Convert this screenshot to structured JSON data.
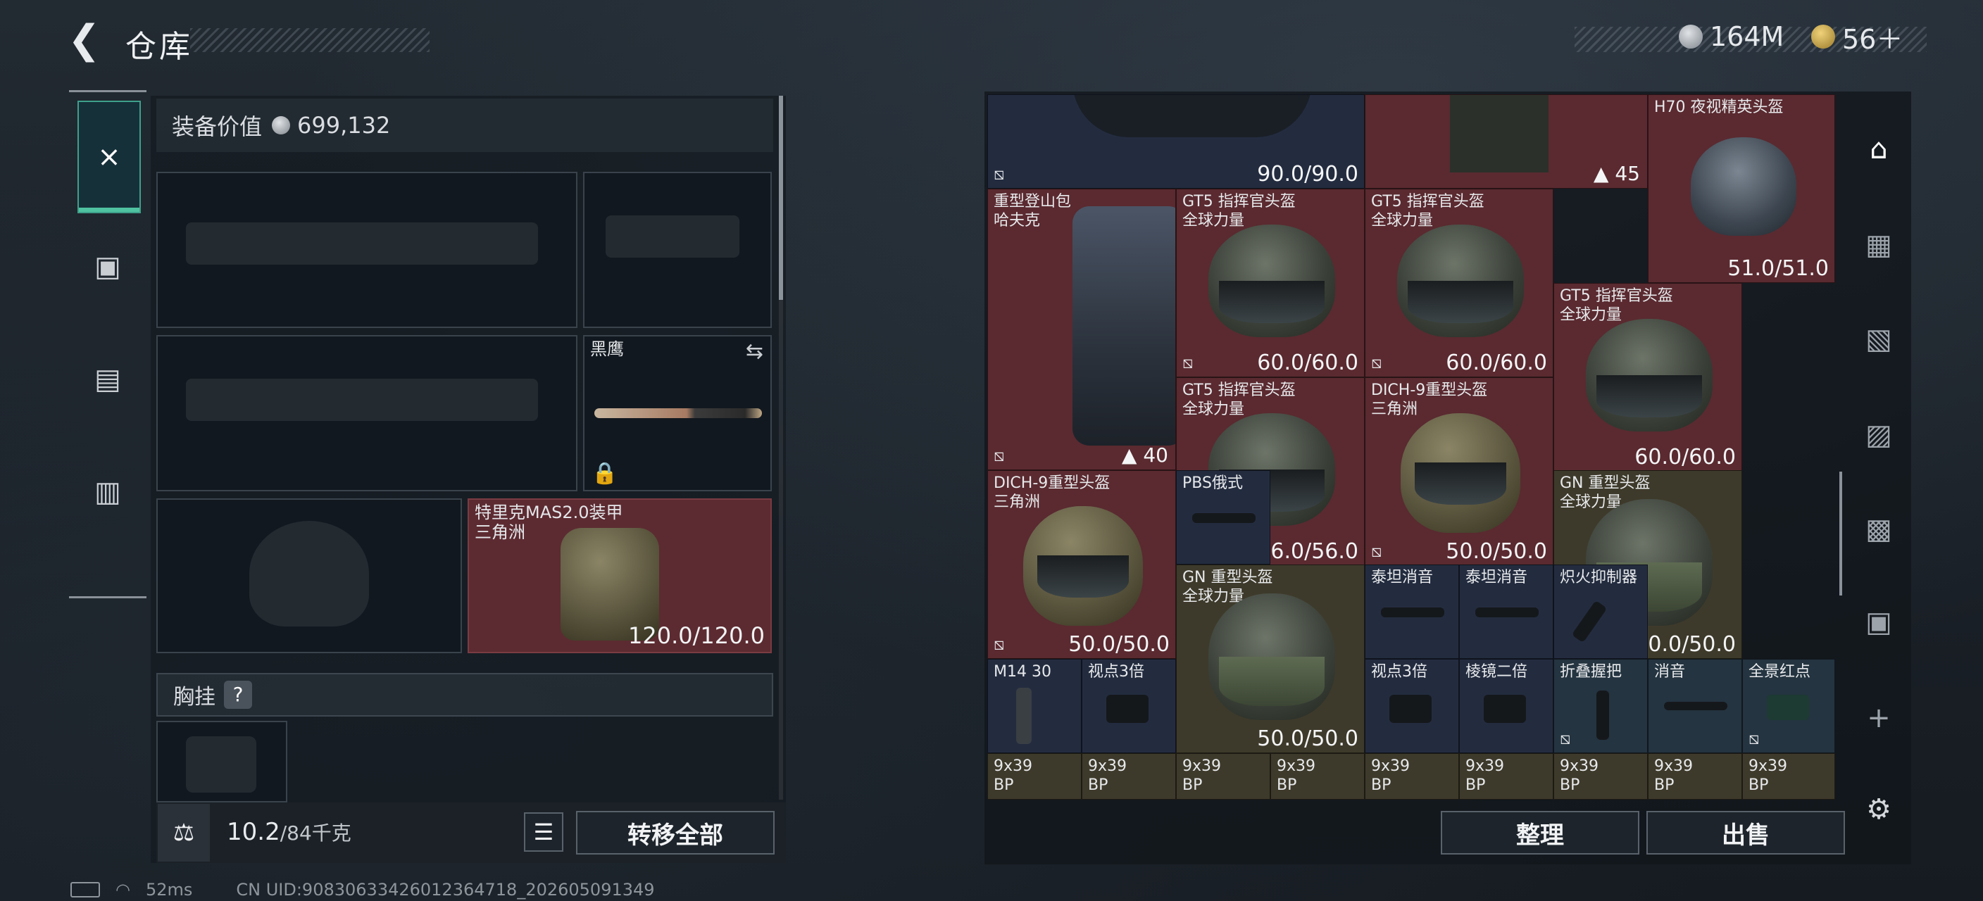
{
  "header": {
    "title": "仓库",
    "currency1": "164M",
    "currency2": "56＋"
  },
  "left": {
    "equip_value_label": "装备价值",
    "equip_value": "699,132",
    "knife_name": "黑鹰",
    "armor": {
      "name": "特里克MAS2.0装甲",
      "sub": "三角洲",
      "durability": "120.0/120.0"
    },
    "chest_label": "胸挂",
    "chest_help": "?",
    "weight": "10.2",
    "weight_max": "/84千克",
    "transfer_all": "转移全部"
  },
  "grid": {
    "c1_dur": "90.0/90.0",
    "c2_count": "45",
    "h70": {
      "name": "H70 夜视精英头盔",
      "dur": "51.0/51.0"
    },
    "backpack": {
      "name": "重型登山包",
      "sub": "哈夫克",
      "count": "40"
    },
    "gt5a": {
      "name": "GT5 指挥官头盔",
      "sub": "全球力量",
      "dur": "60.0/60.0"
    },
    "gt5b": {
      "name": "GT5 指挥官头盔",
      "sub": "全球力量",
      "dur": "60.0/60.0"
    },
    "gt5c": {
      "name": "GT5 指挥官头盔",
      "sub": "全球力量",
      "dur": "60.0/60.0"
    },
    "gt5d": {
      "name": "GT5 指挥官头盔",
      "sub": "全球力量",
      "dur": "56.0/56.0"
    },
    "dich1": {
      "name": "DICH-9重型头盔",
      "sub": "三角洲",
      "dur": "50.0/50.0"
    },
    "dich2": {
      "name": "DICH-9重型头盔",
      "sub": "三角洲",
      "dur": "50.0/50.0"
    },
    "pbs": {
      "name": "PBS俄式"
    },
    "gn1": {
      "name": "GN 重型头盔",
      "sub": "全球力量",
      "dur": "50.0/50.0"
    },
    "gn2": {
      "name": "GN 重型头盔",
      "sub": "全球力量",
      "dur": "50.0/50.0"
    },
    "taitan1": {
      "name": "泰坦消音"
    },
    "taitan2": {
      "name": "泰坦消音"
    },
    "flash": {
      "name": "炽火抑制器"
    },
    "m14": {
      "name": "M14 30"
    },
    "scope3a": {
      "name": "视点3倍"
    },
    "scope3b": {
      "name": "视点3倍"
    },
    "prism2": {
      "name": "棱镜二倍"
    },
    "foldgrip": {
      "name": "折叠握把"
    },
    "silencer": {
      "name": "消音"
    },
    "panred": {
      "name": "全景红点"
    },
    "ammo": [
      "9x39",
      "9x39",
      "9x39",
      "9x39",
      "9x39",
      "9x39",
      "9x39",
      "9x39",
      "9x39"
    ],
    "ammo_sub": "BP"
  },
  "buttons": {
    "sort": "整理",
    "sell": "出售",
    "plus": "+"
  },
  "status": {
    "ping": "52ms",
    "uid": "CN UID:9083063342601236471​8_202605091349"
  }
}
